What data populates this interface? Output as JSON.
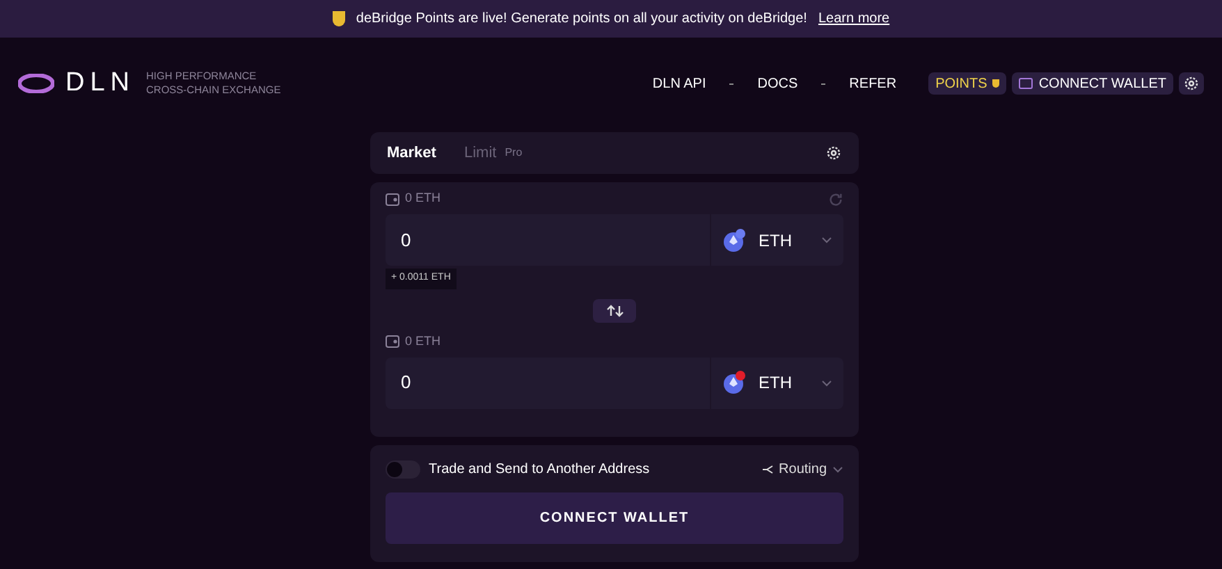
{
  "banner": {
    "text": "deBridge Points are live! Generate points on all your activity on deBridge!",
    "link": "Learn more"
  },
  "header": {
    "logo": "DLN",
    "tagline_1": "HIGH PERFORMANCE",
    "tagline_2": "CROSS-CHAIN EXCHANGE",
    "nav": [
      "DLN API",
      "DOCS",
      "REFER"
    ],
    "points": "POINTS",
    "connect": "CONNECT WALLET"
  },
  "tabs": [
    {
      "label": "Market",
      "selected": true
    },
    {
      "label": "Limit",
      "selected": false,
      "badge": "Pro"
    }
  ],
  "fields": [
    {
      "kind": "from",
      "balance": "0 ETH",
      "value": "0",
      "token": "ETH",
      "color": "#6b7cf0",
      "fee": "+ 0.0011 ETH"
    },
    {
      "kind": "to",
      "balance": "0 ETH",
      "value": "0",
      "token": "ETH",
      "color": "#e11d2a"
    }
  ],
  "send_toggle": {
    "label": "Trade and Send to Another Address",
    "on": false
  },
  "routing": "Routing",
  "connect_button": "CONNECT WALLET"
}
